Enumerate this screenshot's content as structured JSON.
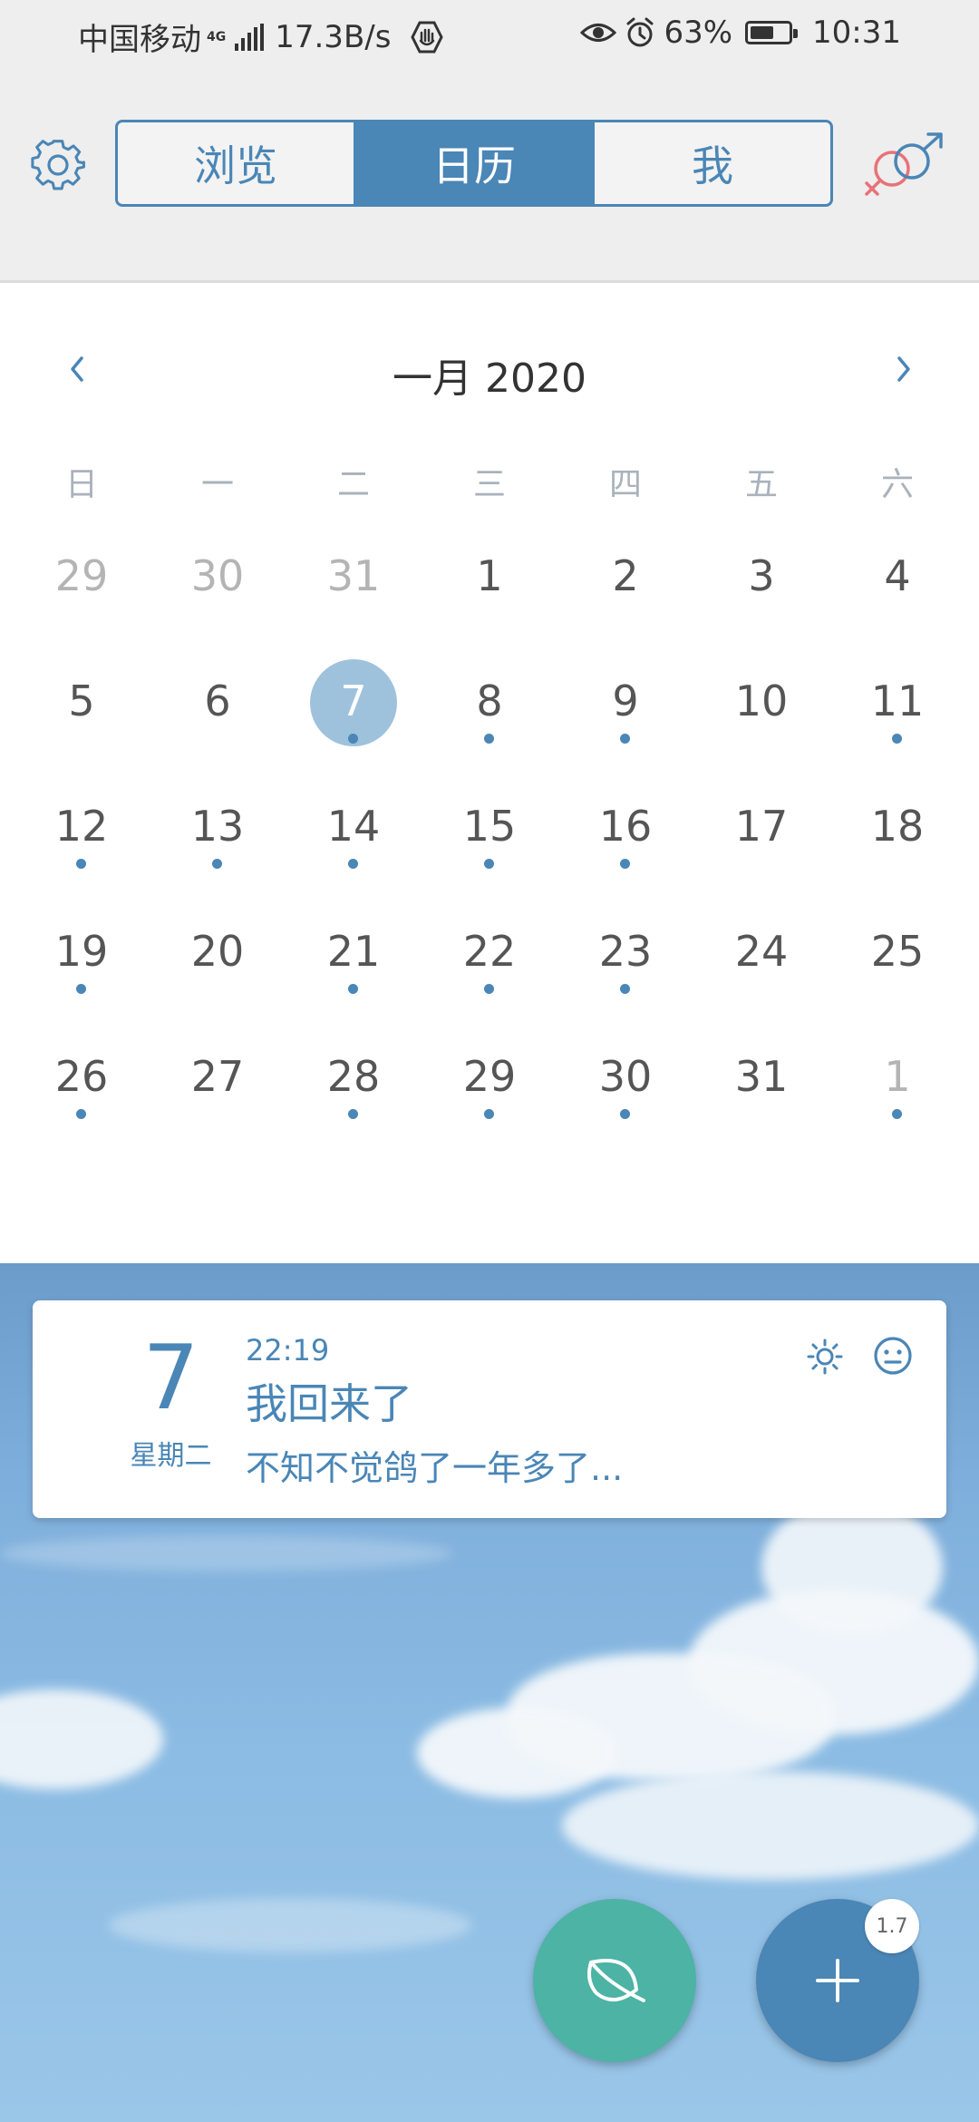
{
  "status_bar": {
    "carrier": "中国移动",
    "network_type": "4G",
    "speed": "17.3B/s",
    "battery_percent": "63%",
    "battery_level": 0.63,
    "time": "10:31",
    "icons": [
      "signal-icon",
      "shield-hand-icon",
      "eye-icon",
      "alarm-icon",
      "battery-icon"
    ]
  },
  "top_nav": {
    "tabs": [
      {
        "label": "浏览",
        "active": false
      },
      {
        "label": "日历",
        "active": true
      },
      {
        "label": "我",
        "active": false
      }
    ],
    "accent_color": "#4a86b6",
    "gender_colors": [
      "#e8727a",
      "#4a86b6"
    ]
  },
  "calendar": {
    "title": "一月 2020",
    "weekdays": [
      "日",
      "一",
      "二",
      "三",
      "四",
      "五",
      "六"
    ],
    "weeks": [
      [
        {
          "day": "29",
          "muted": true,
          "dot": false
        },
        {
          "day": "30",
          "muted": true,
          "dot": false
        },
        {
          "day": "31",
          "muted": true,
          "dot": false
        },
        {
          "day": "1",
          "muted": false,
          "dot": false
        },
        {
          "day": "2",
          "muted": false,
          "dot": false
        },
        {
          "day": "3",
          "muted": false,
          "dot": false
        },
        {
          "day": "4",
          "muted": false,
          "dot": false
        }
      ],
      [
        {
          "day": "5",
          "muted": false,
          "dot": false
        },
        {
          "day": "6",
          "muted": false,
          "dot": false
        },
        {
          "day": "7",
          "muted": false,
          "dot": true,
          "selected": true
        },
        {
          "day": "8",
          "muted": false,
          "dot": true
        },
        {
          "day": "9",
          "muted": false,
          "dot": true
        },
        {
          "day": "10",
          "muted": false,
          "dot": false
        },
        {
          "day": "11",
          "muted": false,
          "dot": true
        }
      ],
      [
        {
          "day": "12",
          "muted": false,
          "dot": true
        },
        {
          "day": "13",
          "muted": false,
          "dot": true
        },
        {
          "day": "14",
          "muted": false,
          "dot": true
        },
        {
          "day": "15",
          "muted": false,
          "dot": true
        },
        {
          "day": "16",
          "muted": false,
          "dot": true
        },
        {
          "day": "17",
          "muted": false,
          "dot": false
        },
        {
          "day": "18",
          "muted": false,
          "dot": false
        }
      ],
      [
        {
          "day": "19",
          "muted": false,
          "dot": true
        },
        {
          "day": "20",
          "muted": false,
          "dot": false
        },
        {
          "day": "21",
          "muted": false,
          "dot": true
        },
        {
          "day": "22",
          "muted": false,
          "dot": true
        },
        {
          "day": "23",
          "muted": false,
          "dot": true
        },
        {
          "day": "24",
          "muted": false,
          "dot": false
        },
        {
          "day": "25",
          "muted": false,
          "dot": false
        }
      ],
      [
        {
          "day": "26",
          "muted": false,
          "dot": true
        },
        {
          "day": "27",
          "muted": false,
          "dot": false
        },
        {
          "day": "28",
          "muted": false,
          "dot": true
        },
        {
          "day": "29",
          "muted": false,
          "dot": true
        },
        {
          "day": "30",
          "muted": false,
          "dot": true
        },
        {
          "day": "31",
          "muted": false,
          "dot": false
        },
        {
          "day": "1",
          "muted": true,
          "dot": true
        }
      ]
    ]
  },
  "entry": {
    "day": "7",
    "weekday": "星期二",
    "time": "22:19",
    "title": "我回来了",
    "snippet": "不知不觉鸽了一年多了..."
  },
  "fab": {
    "version_badge": "1.7",
    "leaf_color": "#4cb3a5",
    "add_color": "#4a86b6"
  }
}
